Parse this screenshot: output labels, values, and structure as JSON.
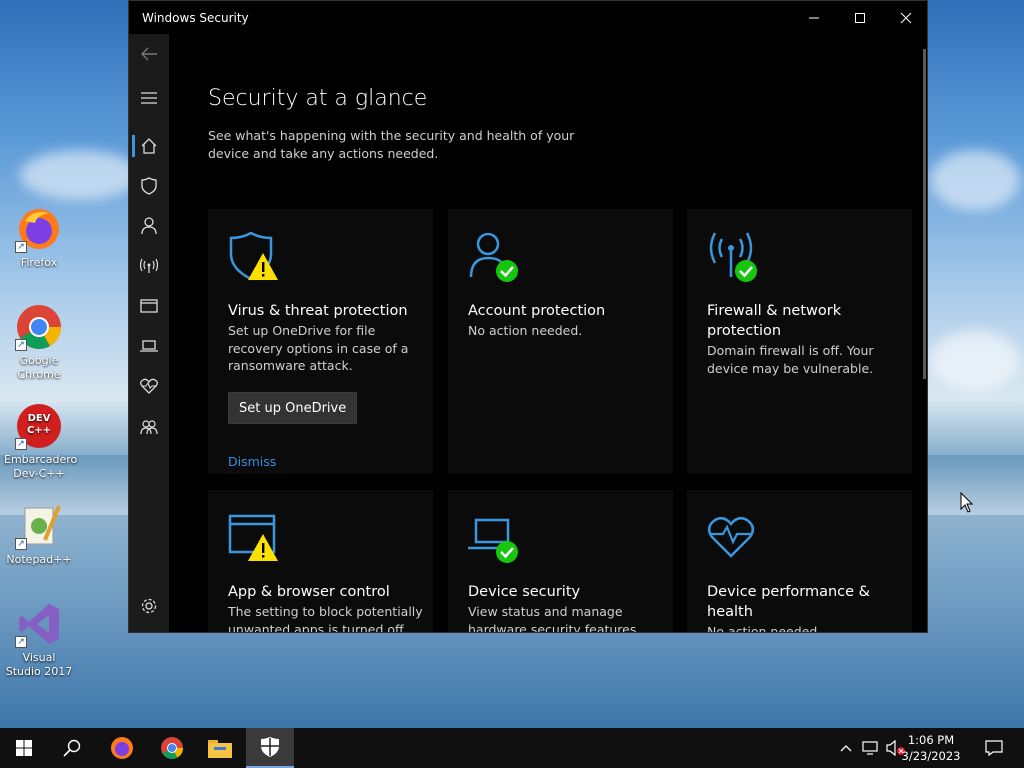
{
  "desktop": {
    "icons": [
      {
        "label": "Firefox",
        "icon": "firefox-icon"
      },
      {
        "label": "Google Chrome",
        "icon": "chrome-icon"
      },
      {
        "label": "Embarcadero Dev-C++",
        "icon": "devcpp-icon"
      },
      {
        "label": "Notepad++",
        "icon": "notepadpp-icon"
      },
      {
        "label": "Visual Studio 2017",
        "icon": "visual-studio-icon"
      }
    ],
    "devcpp_logo_text": "DEV C++"
  },
  "window": {
    "title": "Windows Security",
    "controls": {
      "minimize": "minimize-icon",
      "maximize": "maximize-icon",
      "close": "close-icon"
    }
  },
  "sidebar": {
    "items": [
      {
        "icon": "back-arrow-icon"
      },
      {
        "icon": "hamburger-menu-icon"
      },
      {
        "icon": "home-icon",
        "active": true
      },
      {
        "icon": "shield-icon"
      },
      {
        "icon": "person-icon"
      },
      {
        "icon": "wireless-antenna-icon"
      },
      {
        "icon": "app-browser-icon"
      },
      {
        "icon": "laptop-icon"
      },
      {
        "icon": "heart-pulse-icon"
      },
      {
        "icon": "family-icon"
      },
      {
        "icon": "gear-icon"
      }
    ]
  },
  "main": {
    "title": "Security at a glance",
    "subtitle": "See what's happening with the security and health of your device and take any actions needed.",
    "tiles": [
      {
        "name": "Virus & threat protection",
        "desc": "Set up OneDrive for file recovery options in case of a ransomware attack.",
        "button": "Set up OneDrive",
        "link": "Dismiss",
        "status": "warning"
      },
      {
        "name": "Account protection",
        "desc": "No action needed.",
        "status": "ok"
      },
      {
        "name": "Firewall & network protection",
        "desc": "Domain firewall is off. Your device may be vulnerable.",
        "status": "ok"
      },
      {
        "name": "App & browser control",
        "desc": "The setting to block potentially unwanted apps is turned off.",
        "status": "warning"
      },
      {
        "name": "Device security",
        "desc": "View status and manage hardware security features",
        "status": "ok"
      },
      {
        "name": "Device performance & health",
        "desc": "No action needed.",
        "status": "none"
      }
    ]
  },
  "colors": {
    "accent": "#3a96dd",
    "ok": "#16c60c",
    "warning": "#fce100",
    "link": "#3a8fe0"
  },
  "taskbar": {
    "items": [
      "windows-start-icon",
      "search-icon",
      "firefox-icon",
      "chrome-icon",
      "file-explorer-icon",
      "windows-security-icon"
    ],
    "tray": [
      "chevron-up-icon",
      "network-icon",
      "volume-muted-icon",
      "notifications-icon"
    ],
    "time": "1:06 PM",
    "date": "3/23/2023"
  }
}
